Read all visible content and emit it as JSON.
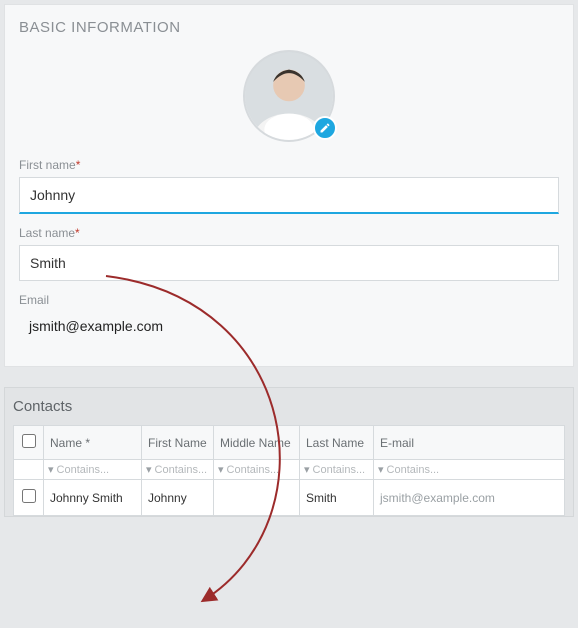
{
  "panel": {
    "title": "BASIC INFORMATION"
  },
  "form": {
    "first_name": {
      "label": "First name",
      "value": "Johnny",
      "required": true
    },
    "last_name": {
      "label": "Last name",
      "value": "Smith",
      "required": true
    },
    "email": {
      "label": "Email",
      "value": "jsmith@example.com"
    }
  },
  "contacts": {
    "title": "Contacts",
    "columns": {
      "name": "Name *",
      "first": "First Name",
      "middle": "Middle Name",
      "last": "Last Name",
      "email": "E-mail"
    },
    "filter_placeholder": "Contains...",
    "rows": [
      {
        "name": "Johnny Smith",
        "first": "Johnny",
        "middle": "",
        "last": "Smith",
        "email": "jsmith@example.com"
      }
    ]
  },
  "colors": {
    "accent": "#1ea7e0",
    "arrow": "#9c2b2b"
  }
}
